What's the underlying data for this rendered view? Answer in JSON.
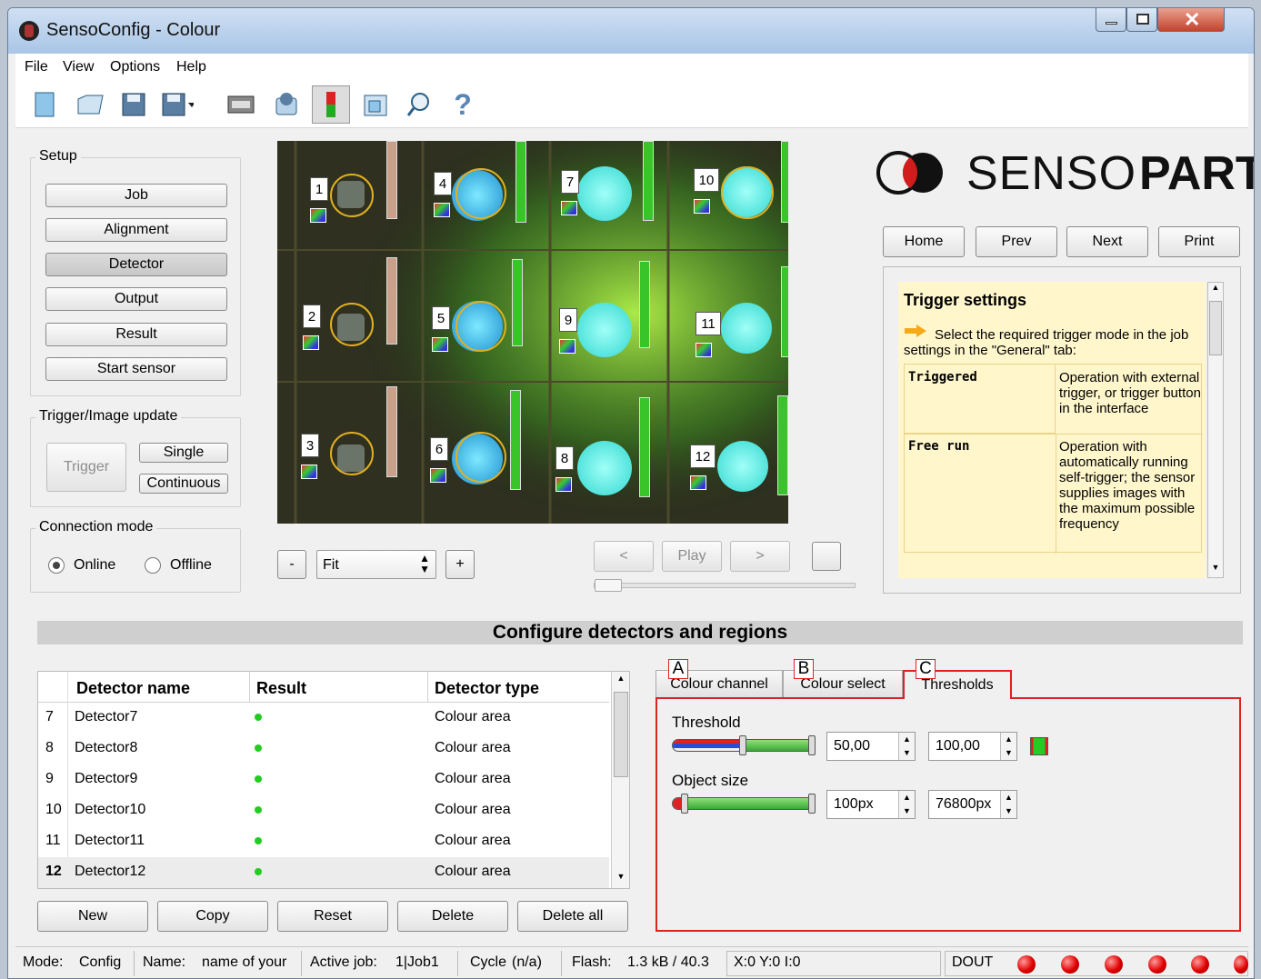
{
  "window": {
    "title": "SensoConfig - Colour"
  },
  "menu": [
    "File",
    "View",
    "Options",
    "Help"
  ],
  "toolbar": [
    "new-icon",
    "open-icon",
    "save-icon",
    "save-as-icon",
    "film-icon",
    "sensor-icon",
    "traffic-light-icon",
    "window-icon",
    "search-icon",
    "help-icon"
  ],
  "setup": {
    "title": "Setup",
    "buttons": [
      "Job",
      "Alignment",
      "Detector",
      "Output",
      "Result",
      "Start sensor"
    ],
    "selected": "Detector"
  },
  "trigger": {
    "title": "Trigger/Image update",
    "trigger_label": "Trigger",
    "single_label": "Single",
    "continuous_label": "Continuous"
  },
  "connection": {
    "title": "Connection mode",
    "online": "Online",
    "offline": "Offline",
    "selected": "Online"
  },
  "image": {
    "detector_labels": [
      "1",
      "2",
      "3",
      "4",
      "5",
      "6",
      "7",
      "8",
      "9",
      "10",
      "11",
      "12"
    ],
    "zoom_minus": "-",
    "zoom_value": "Fit",
    "zoom_plus": "+",
    "prev_label": "<",
    "play_label": "Play",
    "next_label": ">"
  },
  "logo": {
    "text_light": "SENSO",
    "text_bold": "PART"
  },
  "nav": {
    "home": "Home",
    "prev": "Prev",
    "next": "Next",
    "print": "Print"
  },
  "help": {
    "title": "Trigger settings",
    "intro": "Select the required trigger mode in the job settings in the \"General\" tab:",
    "rows": [
      {
        "term": "Triggered",
        "desc": "Operation with external trigger, or trigger button in the interface"
      },
      {
        "term": "Free run",
        "desc": "Operation with automatically running self-trigger; the sensor supplies images with the maximum possible frequency"
      }
    ]
  },
  "section": {
    "title": "Configure detectors and regions"
  },
  "table": {
    "headers": [
      "Detector name",
      "Result",
      "Detector type"
    ],
    "rows": [
      {
        "idx": "7",
        "name": "Detector7",
        "type": "Colour area"
      },
      {
        "idx": "8",
        "name": "Detector8",
        "type": "Colour area"
      },
      {
        "idx": "9",
        "name": "Detector9",
        "type": "Colour area"
      },
      {
        "idx": "10",
        "name": "Detector10",
        "type": "Colour area"
      },
      {
        "idx": "11",
        "name": "Detector11",
        "type": "Colour area"
      },
      {
        "idx": "12",
        "name": "Detector12",
        "type": "Colour area"
      }
    ],
    "selected_row": "12"
  },
  "actions": [
    "New",
    "Copy",
    "Reset",
    "Delete",
    "Delete all"
  ],
  "tabs": {
    "items": [
      {
        "marker": "A",
        "label": "Colour channel"
      },
      {
        "marker": "B",
        "label": "Colour select"
      },
      {
        "marker": "C",
        "label": "Thresholds"
      }
    ],
    "active": "Thresholds"
  },
  "thresholds": {
    "threshold_label": "Threshold",
    "threshold_min": "50,00",
    "threshold_max": "100,00",
    "object_label": "Object size",
    "object_min": "100px",
    "object_max": "76800px"
  },
  "status": {
    "mode_label": "Mode:",
    "mode_value": "Config",
    "name_label": "Name:",
    "name_value": "name of your",
    "job_label": "Active job:",
    "job_value": "1|Job1",
    "cycle_label": "Cycle",
    "cycle_value": "(n/a)",
    "flash_label": "Flash:",
    "flash_value": "1.3 kB / 40.3",
    "coords": "X:0 Y:0 I:0",
    "dout": "DOUT",
    "led_count": 6
  }
}
